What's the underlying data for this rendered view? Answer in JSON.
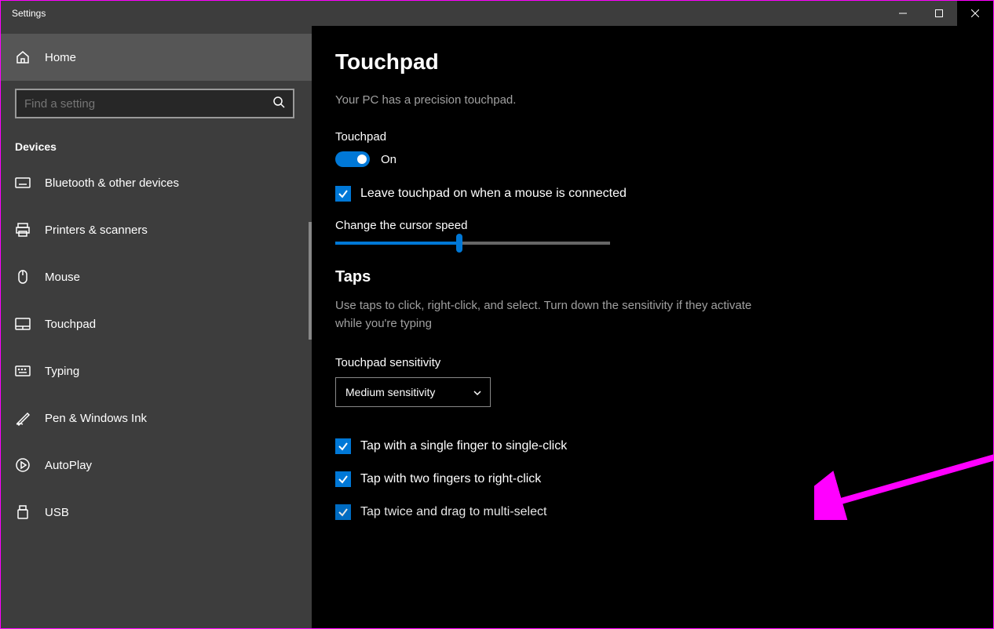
{
  "window": {
    "title": "Settings"
  },
  "sidebar": {
    "home": "Home",
    "search_placeholder": "Find a setting",
    "section": "Devices",
    "items": [
      {
        "label": "Bluetooth & other devices"
      },
      {
        "label": "Printers & scanners"
      },
      {
        "label": "Mouse"
      },
      {
        "label": "Touchpad"
      },
      {
        "label": "Typing"
      },
      {
        "label": "Pen & Windows Ink"
      },
      {
        "label": "AutoPlay"
      },
      {
        "label": "USB"
      }
    ]
  },
  "main": {
    "title": "Touchpad",
    "subtitle": "Your PC has a precision touchpad.",
    "touchpad_label": "Touchpad",
    "toggle_state": "On",
    "leave_on_label": "Leave touchpad on when a mouse is connected",
    "cursor_speed_label": "Change the cursor speed",
    "taps": {
      "heading": "Taps",
      "desc": "Use taps to click, right-click, and select. Turn down the sensitivity if they activate while you're typing",
      "sensitivity_label": "Touchpad sensitivity",
      "sensitivity_value": "Medium sensitivity",
      "checks": [
        "Tap with a single finger to single-click",
        "Tap with two fingers to right-click",
        "Tap twice and drag to multi-select"
      ]
    }
  }
}
